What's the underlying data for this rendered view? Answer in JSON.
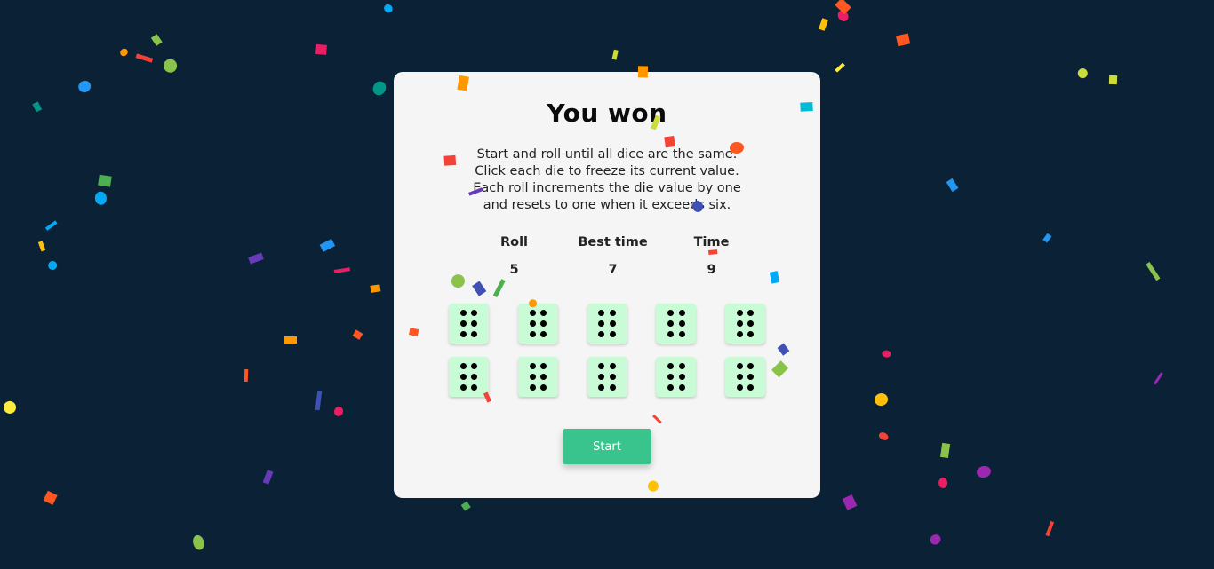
{
  "game": {
    "title": "You won",
    "instructions": [
      "Start and roll until all dice are the same.",
      "Click each die to freeze its current value.",
      "Each roll increments the die value by one",
      "and resets to one when it exceeds six."
    ],
    "stats": [
      {
        "label": "Roll",
        "value": "5"
      },
      {
        "label": "Best time",
        "value": "7"
      },
      {
        "label": "Time",
        "value": "9"
      }
    ],
    "dice": [
      6,
      6,
      6,
      6,
      6,
      6,
      6,
      6,
      6,
      6
    ],
    "start_label": "Start"
  },
  "colors": {
    "background": "#0b2236",
    "card": "#f5f5f5",
    "die_face": "#c8fbd6",
    "pip": "#000000",
    "button": "#3ac48d",
    "confetti_palette": [
      "#f44336",
      "#e91e63",
      "#9c27b0",
      "#673ab7",
      "#3f51b5",
      "#2196f3",
      "#03a9f4",
      "#00bcd4",
      "#009688",
      "#4caf50",
      "#8bc34a",
      "#cddc39",
      "#ffeb3b",
      "#ffc107",
      "#ff9800",
      "#ff5722"
    ]
  },
  "decorations": {
    "confetti": "falling-confetti"
  }
}
